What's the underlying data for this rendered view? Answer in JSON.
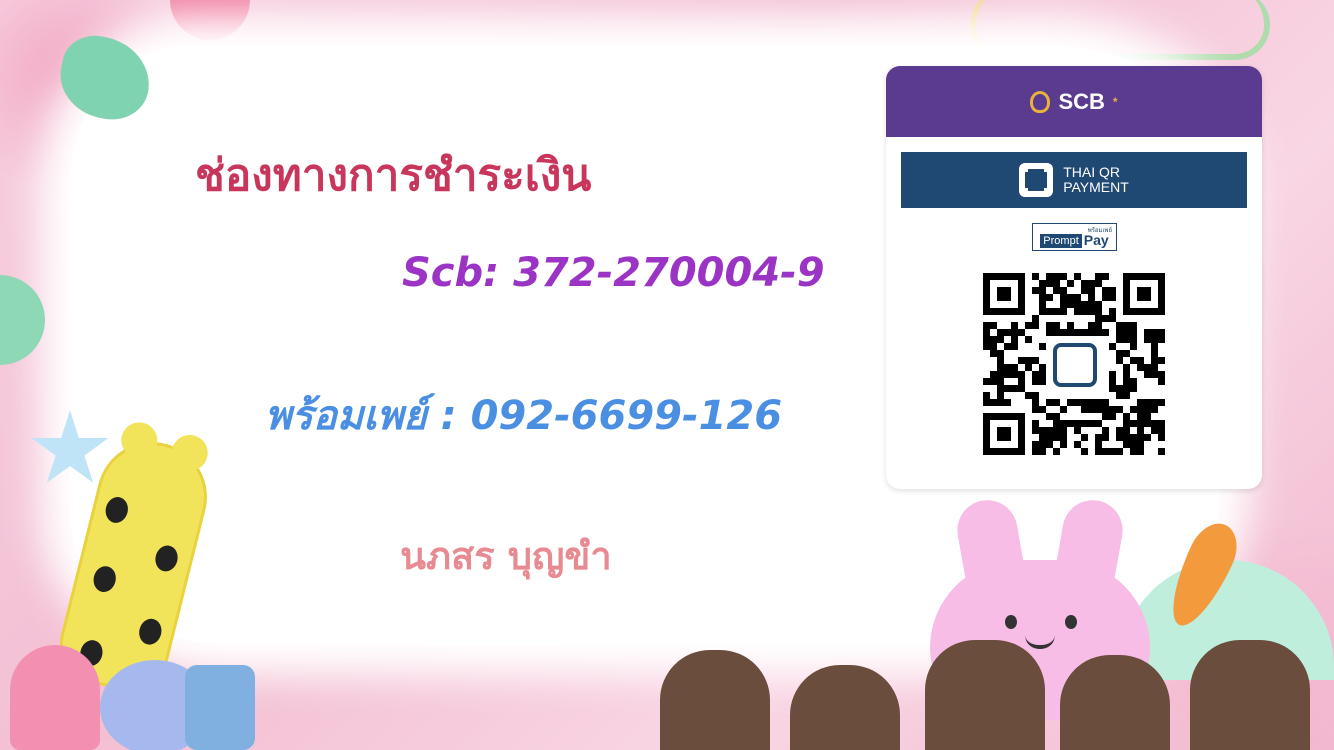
{
  "title": "ช่องทางการชำระเงิน",
  "scb_account_line": "Scb: 372-270004-9",
  "promptpay_line": "พร้อมเพย์ : 092-6699-126",
  "holder_name": "นภสร บุญขำ",
  "qr_card": {
    "bank_name": "SCB",
    "bank_star": "*",
    "thai_qr_line1": "THAI QR",
    "thai_qr_line2": "PAYMENT",
    "promptpay_small": "พร้อมเพย์",
    "promptpay_prompt": "Prompt",
    "promptpay_pay": "Pay"
  },
  "colors": {
    "title": "#c8375b",
    "scb_account": "#9b34c4",
    "promptpay": "#4a8fe2",
    "holder": "#e88a91",
    "scb_purple": "#5a3b8f",
    "thai_qr_navy": "#1f4873"
  }
}
